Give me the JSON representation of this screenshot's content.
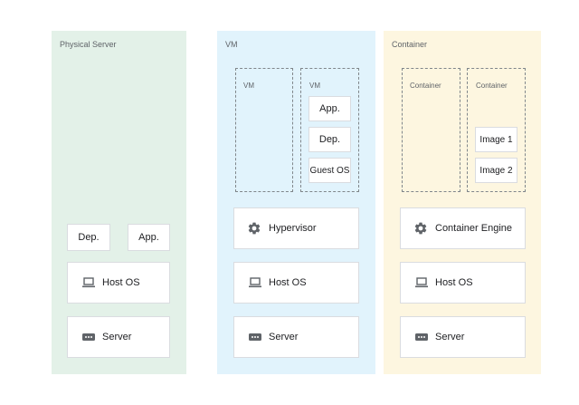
{
  "colors": {
    "physical_bg": "#e3f1e8",
    "vm_bg": "#e1f3fc",
    "container_bg": "#fdf6e0",
    "icon": "#5f6368"
  },
  "physical": {
    "title": "Physical Server",
    "dep": "Dep.",
    "app": "App.",
    "host_os": "Host OS",
    "server": "Server"
  },
  "vm": {
    "title": "VM",
    "vm1_title": "VM",
    "vm2_title": "VM",
    "vm2_app": "App.",
    "vm2_dep": "Dep.",
    "vm2_guest_os": "Guest OS",
    "hypervisor": "Hypervisor",
    "host_os": "Host OS",
    "server": "Server"
  },
  "container": {
    "title": "Container",
    "c1_title": "Container",
    "c2_title": "Container",
    "image1": "Image 1",
    "image2": "Image 2",
    "engine": "Container Engine",
    "host_os": "Host OS",
    "server": "Server"
  },
  "icons": [
    "gear-icon",
    "laptop-icon",
    "server-icon"
  ]
}
